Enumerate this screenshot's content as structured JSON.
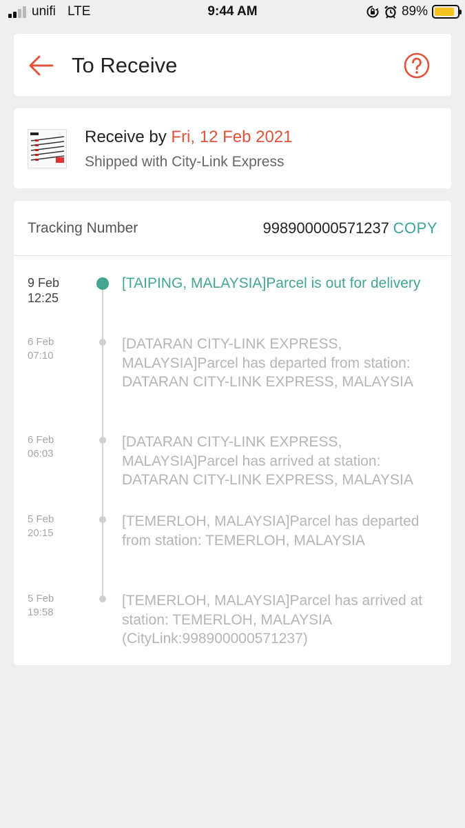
{
  "status_bar": {
    "carrier": "unifi",
    "network": "LTE",
    "time": "9:44 AM",
    "battery_percent": "89%",
    "battery_level": 0.89,
    "battery_color": "#f5c320",
    "icons": [
      "signal-icon",
      "rotation-lock-icon",
      "alarm-icon",
      "battery-icon"
    ]
  },
  "header": {
    "title": "To Receive",
    "back_icon": "arrow-left-icon",
    "help_icon": "question-circle-icon",
    "accent_color": "#e0533a"
  },
  "shipping": {
    "receive_by_label": "Receive by",
    "receive_by_date": "Fri, 12 Feb 2021",
    "shipped_with": "Shipped with City-Link Express"
  },
  "tracking": {
    "label": "Tracking Number",
    "number": "998900000571237",
    "copy_label": "COPY",
    "accent_color": "#44a592",
    "events": [
      {
        "day": "9 Feb",
        "time": "12:25",
        "description": "[TAIPING, MALAYSIA]Parcel is out for delivery",
        "active": true
      },
      {
        "day": "6 Feb",
        "time": "07:10",
        "description": "[DATARAN CITY-LINK EXPRESS, MALAYSIA]Parcel has departed from station: DATARAN CITY-LINK EXPRESS, MALAYSIA",
        "active": false
      },
      {
        "day": "6 Feb",
        "time": "06:03",
        "description": "[DATARAN CITY-LINK EXPRESS, MALAYSIA]Parcel has arrived at station: DATARAN CITY-LINK EXPRESS, MALAYSIA",
        "active": false
      },
      {
        "day": "5 Feb",
        "time": "20:15",
        "description": "[TEMERLOH, MALAYSIA]Parcel has departed from station: TEMERLOH, MALAYSIA",
        "active": false
      },
      {
        "day": "5 Feb",
        "time": "19:58",
        "description": "[TEMERLOH, MALAYSIA]Parcel has arrived at station: TEMERLOH, MALAYSIA (CityLink:998900000571237)",
        "active": false
      }
    ]
  }
}
